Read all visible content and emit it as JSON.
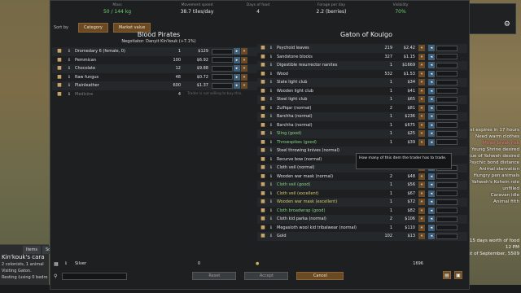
{
  "stats": {
    "mass": {
      "label": "Mass",
      "value": "50 / 144 kg"
    },
    "movement": {
      "label": "Movement speed",
      "value": "38.7 tiles/day"
    },
    "days_food": {
      "label": "Days of food",
      "value": "4"
    },
    "forage": {
      "label": "Forage per day",
      "value": "2.2 (berries)"
    },
    "visibility": {
      "label": "Visibility",
      "value": "70%"
    }
  },
  "sort": {
    "label": "Sort by",
    "category": "Category",
    "market_value": "Market value"
  },
  "trader": {
    "name": "Blood Pirates",
    "negotiator": "Negotiator: Danyit Kin'kouk (+7.1%)"
  },
  "colony": {
    "name": "Gaton of Koulgo"
  },
  "left_items": [
    {
      "icon": "horse-icon",
      "name": "Dromedary 6 (female, 0)",
      "qty": "1",
      "price": "$129",
      "field": "0"
    },
    {
      "icon": "food-icon",
      "name": "Pemmican",
      "qty": "100",
      "price": "$6.92",
      "field": "0"
    },
    {
      "icon": "chocolate-icon",
      "name": "Chocolate",
      "qty": "12",
      "price": "$9.88",
      "field": "0"
    },
    {
      "icon": "fungus-icon",
      "name": "Raw fungus",
      "qty": "48",
      "price": "$0.72",
      "field": "0"
    },
    {
      "icon": "leather-icon",
      "name": "Plainleather",
      "qty": "600",
      "price": "$1.37",
      "field": "0"
    },
    {
      "icon": "medicine-icon",
      "name": "Medicine",
      "qty": "4",
      "note": "Trader is not willing to buy this."
    }
  ],
  "right_items": [
    {
      "icon": "leaf-icon",
      "name": "Psychoid leaves",
      "style": "",
      "qty": "219",
      "price": "$2.42",
      "field": "0"
    },
    {
      "icon": "stone-icon",
      "name": "Sandstone blocks",
      "style": "",
      "qty": "327",
      "price": "$1.15",
      "field": "0"
    },
    {
      "icon": "nanites-icon",
      "name": "Digestible resurrector nanites",
      "style": "",
      "qty": "1",
      "price": "$1669",
      "field": "0"
    },
    {
      "icon": "wood-icon",
      "name": "Wood",
      "style": "",
      "qty": "532",
      "price": "$1.53",
      "field": "0"
    },
    {
      "icon": "info-icon",
      "name": "Slate light club",
      "style": "",
      "qty": "1",
      "price": "$34",
      "field": "0"
    },
    {
      "icon": "info-icon",
      "name": "Wooden light club",
      "style": "",
      "qty": "1",
      "price": "$41",
      "field": "0"
    },
    {
      "icon": "info-icon",
      "name": "Steel light club",
      "style": "",
      "qty": "1",
      "price": "$65",
      "field": "0"
    },
    {
      "icon": "info-icon",
      "name": "Zulfiqar (normal)",
      "style": "",
      "qty": "2",
      "price": "$81",
      "field": "0"
    },
    {
      "icon": "info-icon",
      "name": "Barchha (normal)",
      "style": "",
      "qty": "1",
      "price": "$236",
      "field": "0"
    },
    {
      "icon": "info-icon",
      "name": "Barchha (normal)",
      "style": "",
      "qty": "1",
      "price": "$675",
      "field": "0"
    },
    {
      "icon": "info-icon",
      "name": "Sling (good)",
      "style": "green",
      "qty": "1",
      "price": "$25",
      "field": "0"
    },
    {
      "icon": "info-icon",
      "name": "Throwspikes (good)",
      "style": "green",
      "qty": "1",
      "price": "$39",
      "field": "0"
    },
    {
      "icon": "info-icon",
      "name": "Steel throwing knives (normal)",
      "style": "",
      "qty": "",
      "price": "",
      "field": ""
    },
    {
      "icon": "info-icon",
      "name": "Recurve bow (normal)",
      "style": "",
      "qty": "",
      "price": "",
      "field": ""
    },
    {
      "icon": "veil-icon",
      "name": "Cloth veil (normal)",
      "style": "",
      "qty": "1",
      "price": "$45",
      "field": "0"
    },
    {
      "icon": "mask-icon",
      "name": "Wooden war mask (normal)",
      "style": "",
      "qty": "2",
      "price": "$48",
      "field": "0"
    },
    {
      "icon": "veil-icon",
      "name": "Cloth veil (good)",
      "style": "green",
      "qty": "1",
      "price": "$56",
      "field": "0"
    },
    {
      "icon": "veil-icon",
      "name": "Cloth veil (excellent)",
      "style": "yellow",
      "qty": "1",
      "price": "$67",
      "field": "0"
    },
    {
      "icon": "mask-icon",
      "name": "Wooden war mask (excellent)",
      "style": "yellow",
      "qty": "1",
      "price": "$72",
      "field": "0"
    },
    {
      "icon": "shield-icon",
      "name": "Cloth broadwrap (good)",
      "style": "green",
      "qty": "1",
      "price": "$82",
      "field": "0"
    },
    {
      "icon": "parka-icon",
      "name": "Cloth kid parka (normal)",
      "style": "",
      "qty": "2",
      "price": "$106",
      "field": "0"
    },
    {
      "icon": "info-icon",
      "name": "Megasloth wool kid tribalwear (normal)",
      "style": "",
      "qty": "1",
      "price": "$110",
      "field": "0"
    },
    {
      "icon": "gold-icon",
      "name": "Gold",
      "style": "",
      "qty": "102",
      "price": "$13",
      "field": "0"
    }
  ],
  "tooltip": "How many of this item the trader has to trade.",
  "silver": {
    "name": "Silver",
    "left_qty": "0",
    "right_qty": "1696"
  },
  "buttons": {
    "reset": "Reset",
    "accept": "Accept",
    "cancel": "Cancel"
  },
  "inspect": {
    "tabs": [
      "Items",
      "Social"
    ],
    "title": "Kin'kouk's cara",
    "lines": [
      "2 colonists, 1 animal",
      "Visiting Gaton.",
      "Resting (using 0 bedro"
    ]
  },
  "alerts": [
    "Quest expires in 17 hours",
    "Need warm clothes",
    "Minor break risk",
    "Young Shrine desired",
    "Statue of Yahweh desired",
    "Psychic bond distance",
    "Animal starvation",
    "Hungry pen animals",
    "Yahweh's Kohein role unfilled",
    "Caravan idle",
    "Animal filth"
  ],
  "time": {
    "food": "15 days worth of food",
    "clock": "12 PM",
    "date": "1st of September, 5509"
  }
}
